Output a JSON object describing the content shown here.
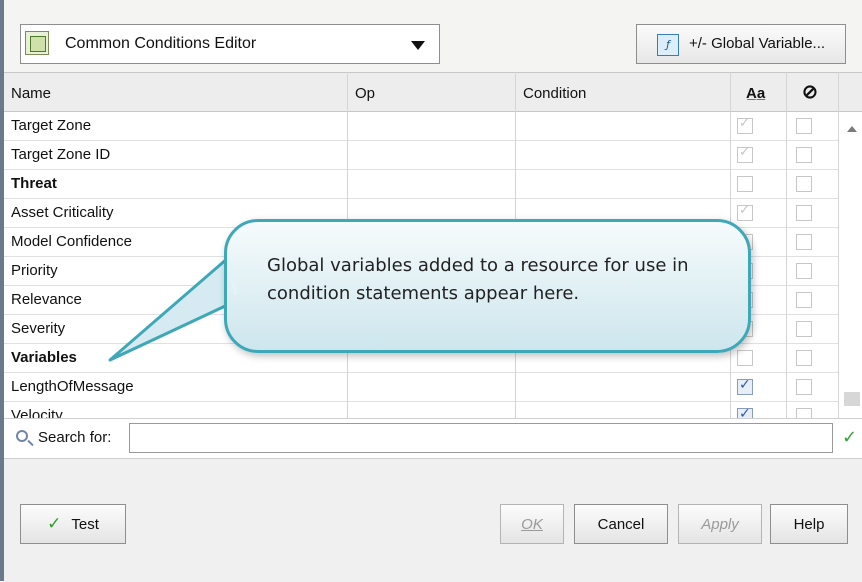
{
  "toolbar": {
    "editor_select_value": "Common Conditions Editor",
    "global_variable_button": "+/- Global Variable..."
  },
  "table": {
    "columns": [
      "Name",
      "Op",
      "Condition",
      "A̲a̲",
      "⊘"
    ],
    "rows": [
      {
        "name": "Target Zone",
        "bold": false,
        "case": "disabled",
        "not": false
      },
      {
        "name": "Target Zone ID",
        "bold": false,
        "case": "disabled",
        "not": false
      },
      {
        "name": "Threat",
        "bold": true,
        "case": "none",
        "not": false
      },
      {
        "name": "Asset Criticality",
        "bold": false,
        "case": "disabled",
        "not": false
      },
      {
        "name": "Model Confidence",
        "bold": false,
        "case": "none",
        "not": false
      },
      {
        "name": "Priority",
        "bold": false,
        "case": "none",
        "not": false
      },
      {
        "name": "Relevance",
        "bold": false,
        "case": "none",
        "not": false
      },
      {
        "name": "Severity",
        "bold": false,
        "case": "disabled",
        "not": false
      },
      {
        "name": "Variables",
        "bold": true,
        "case": "none",
        "not": false
      },
      {
        "name": "LengthOfMessage",
        "bold": false,
        "case": "checked",
        "not": false
      },
      {
        "name": "Velocity",
        "bold": false,
        "case": "checked",
        "not": false
      }
    ]
  },
  "search": {
    "label": "Search for:",
    "value": ""
  },
  "buttons": {
    "test": "Test",
    "ok": "OK",
    "cancel": "Cancel",
    "apply": "Apply",
    "help": "Help"
  },
  "callout": {
    "text": "Global variables added to a resource for use in condition statements appear here."
  },
  "colors": {
    "callout_border": "#3ea7b8",
    "checkbox_checked": "#2c59a8",
    "test_check": "#2f9e2f"
  }
}
